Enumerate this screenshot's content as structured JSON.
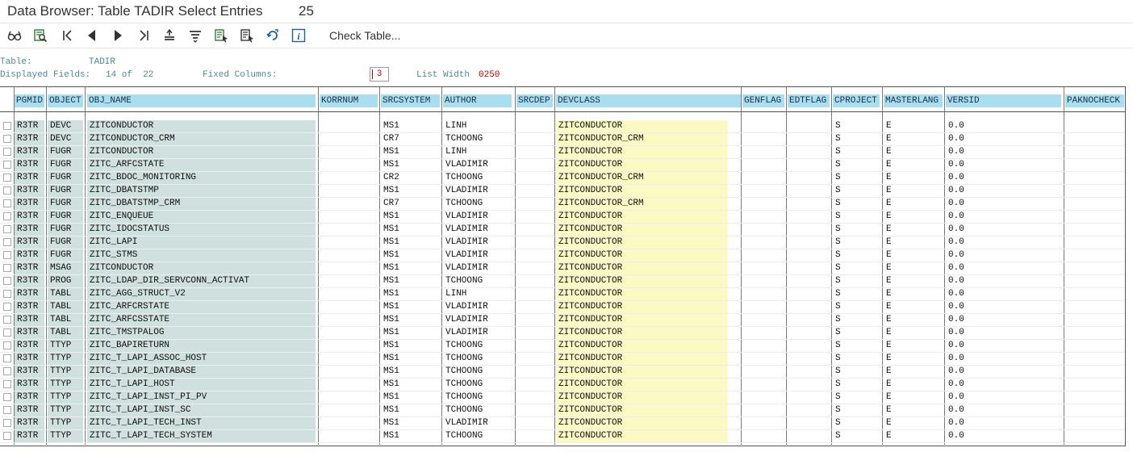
{
  "window": {
    "title": "Data Browser: Table TADIR Select Entries",
    "entry_count": "25"
  },
  "toolbar": {
    "buttons": [
      {
        "icon": "glasses-icon"
      },
      {
        "icon": "find-icon"
      },
      {
        "icon": "first-page-icon"
      },
      {
        "icon": "previous-page-icon"
      },
      {
        "icon": "next-page-icon"
      },
      {
        "icon": "last-page-icon"
      },
      {
        "icon": "sort-ascending-icon"
      },
      {
        "icon": "sort-descending-icon"
      },
      {
        "icon": "choose-detail-icon"
      },
      {
        "icon": "print-icon"
      },
      {
        "icon": "refresh-icon"
      },
      {
        "icon": "info-icon"
      }
    ],
    "check_table_label": "Check Table..."
  },
  "info": {
    "table_label": "Table:",
    "table_value": "TADIR",
    "displayed_fields_label": "Displayed Fields:",
    "displayed_fields_value": "14 of  22",
    "fixed_columns_label": "Fixed Columns:",
    "fixed_columns_value": "3",
    "list_width_label": "List Width",
    "list_width_value": "0250"
  },
  "columns": [
    "PGMID",
    "OBJECT",
    "OBJ_NAME",
    "KORRNUM",
    "SRCSYSTEM",
    "AUTHOR",
    "SRCDEP",
    "DEVCLASS",
    "GENFLAG",
    "EDTFLAG",
    "CPROJECT",
    "MASTERLANG",
    "VERSID",
    "PAKNOCHECK"
  ],
  "rows": [
    [
      "R3TR",
      "DEVC",
      "ZITCONDUCTOR",
      "",
      "MS1",
      "LINH",
      "",
      "ZITCONDUCTOR",
      "",
      "",
      "S",
      "E",
      "0.0",
      ""
    ],
    [
      "R3TR",
      "DEVC",
      "ZITCONDUCTOR_CRM",
      "",
      "CR7",
      "TCHOONG",
      "",
      "ZITCONDUCTOR_CRM",
      "",
      "",
      "S",
      "E",
      "0.0",
      ""
    ],
    [
      "R3TR",
      "FUGR",
      "ZITCONDUCTOR",
      "",
      "MS1",
      "LINH",
      "",
      "ZITCONDUCTOR",
      "",
      "",
      "S",
      "E",
      "0.0",
      ""
    ],
    [
      "R3TR",
      "FUGR",
      "ZITC_ARFCSTATE",
      "",
      "MS1",
      "VLADIMIR",
      "",
      "ZITCONDUCTOR",
      "",
      "",
      "S",
      "E",
      "0.0",
      ""
    ],
    [
      "R3TR",
      "FUGR",
      "ZITC_BDOC_MONITORING",
      "",
      "CR2",
      "TCHOONG",
      "",
      "ZITCONDUCTOR_CRM",
      "",
      "",
      "S",
      "E",
      "0.0",
      ""
    ],
    [
      "R3TR",
      "FUGR",
      "ZITC_DBATSTMP",
      "",
      "MS1",
      "VLADIMIR",
      "",
      "ZITCONDUCTOR",
      "",
      "",
      "S",
      "E",
      "0.0",
      ""
    ],
    [
      "R3TR",
      "FUGR",
      "ZITC_DBATSTMP_CRM",
      "",
      "CR7",
      "TCHOONG",
      "",
      "ZITCONDUCTOR_CRM",
      "",
      "",
      "S",
      "E",
      "0.0",
      ""
    ],
    [
      "R3TR",
      "FUGR",
      "ZITC_ENQUEUE",
      "",
      "MS1",
      "VLADIMIR",
      "",
      "ZITCONDUCTOR",
      "",
      "",
      "S",
      "E",
      "0.0",
      ""
    ],
    [
      "R3TR",
      "FUGR",
      "ZITC_IDOCSTATUS",
      "",
      "MS1",
      "VLADIMIR",
      "",
      "ZITCONDUCTOR",
      "",
      "",
      "S",
      "E",
      "0.0",
      ""
    ],
    [
      "R3TR",
      "FUGR",
      "ZITC_LAPI",
      "",
      "MS1",
      "VLADIMIR",
      "",
      "ZITCONDUCTOR",
      "",
      "",
      "S",
      "E",
      "0.0",
      ""
    ],
    [
      "R3TR",
      "FUGR",
      "ZITC_STMS",
      "",
      "MS1",
      "VLADIMIR",
      "",
      "ZITCONDUCTOR",
      "",
      "",
      "S",
      "E",
      "0.0",
      ""
    ],
    [
      "R3TR",
      "MSAG",
      "ZITCONDUCTOR",
      "",
      "MS1",
      "VLADIMIR",
      "",
      "ZITCONDUCTOR",
      "",
      "",
      "S",
      "E",
      "0.0",
      ""
    ],
    [
      "R3TR",
      "PROG",
      "ZITC_LDAP_DIR_SERVCONN_ACTIVAT",
      "",
      "MS1",
      "TCHOONG",
      "",
      "ZITCONDUCTOR",
      "",
      "",
      "S",
      "E",
      "0.0",
      ""
    ],
    [
      "R3TR",
      "TABL",
      "ZITC_AGG_STRUCT_V2",
      "",
      "MS1",
      "LINH",
      "",
      "ZITCONDUCTOR",
      "",
      "",
      "S",
      "E",
      "0.0",
      ""
    ],
    [
      "R3TR",
      "TABL",
      "ZITC_ARFCRSTATE",
      "",
      "MS1",
      "VLADIMIR",
      "",
      "ZITCONDUCTOR",
      "",
      "",
      "S",
      "E",
      "0.0",
      ""
    ],
    [
      "R3TR",
      "TABL",
      "ZITC_ARFCSSTATE",
      "",
      "MS1",
      "VLADIMIR",
      "",
      "ZITCONDUCTOR",
      "",
      "",
      "S",
      "E",
      "0.0",
      ""
    ],
    [
      "R3TR",
      "TABL",
      "ZITC_TMSTPALOG",
      "",
      "MS1",
      "VLADIMIR",
      "",
      "ZITCONDUCTOR",
      "",
      "",
      "S",
      "E",
      "0.0",
      ""
    ],
    [
      "R3TR",
      "TTYP",
      "ZITC_BAPIRETURN",
      "",
      "MS1",
      "TCHOONG",
      "",
      "ZITCONDUCTOR",
      "",
      "",
      "S",
      "E",
      "0.0",
      ""
    ],
    [
      "R3TR",
      "TTYP",
      "ZITC_T_LAPI_ASSOC_HOST",
      "",
      "MS1",
      "TCHOONG",
      "",
      "ZITCONDUCTOR",
      "",
      "",
      "S",
      "E",
      "0.0",
      ""
    ],
    [
      "R3TR",
      "TTYP",
      "ZITC_T_LAPI_DATABASE",
      "",
      "MS1",
      "TCHOONG",
      "",
      "ZITCONDUCTOR",
      "",
      "",
      "S",
      "E",
      "0.0",
      ""
    ],
    [
      "R3TR",
      "TTYP",
      "ZITC_T_LAPI_HOST",
      "",
      "MS1",
      "TCHOONG",
      "",
      "ZITCONDUCTOR",
      "",
      "",
      "S",
      "E",
      "0.0",
      ""
    ],
    [
      "R3TR",
      "TTYP",
      "ZITC_T_LAPI_INST_PI_PV",
      "",
      "MS1",
      "TCHOONG",
      "",
      "ZITCONDUCTOR",
      "",
      "",
      "S",
      "E",
      "0.0",
      ""
    ],
    [
      "R3TR",
      "TTYP",
      "ZITC_T_LAPI_INST_SC",
      "",
      "MS1",
      "TCHOONG",
      "",
      "ZITCONDUCTOR",
      "",
      "",
      "S",
      "E",
      "0.0",
      ""
    ],
    [
      "R3TR",
      "TTYP",
      "ZITC_T_LAPI_TECH_INST",
      "",
      "MS1",
      "VLADIMIR",
      "",
      "ZITCONDUCTOR",
      "",
      "",
      "S",
      "E",
      "0.0",
      ""
    ],
    [
      "R3TR",
      "TTYP",
      "ZITC_T_LAPI_TECH_SYSTEM",
      "",
      "MS1",
      "TCHOONG",
      "",
      "ZITCONDUCTOR",
      "",
      "",
      "S",
      "E",
      "0.0",
      ""
    ]
  ],
  "colors": {
    "header_bg": "#a9def0",
    "key_bg": "#cfe0de",
    "devclass_bg": "#fbf9c4",
    "icon_blue": "#1f5f9f",
    "icon_green": "#2e7d32"
  }
}
